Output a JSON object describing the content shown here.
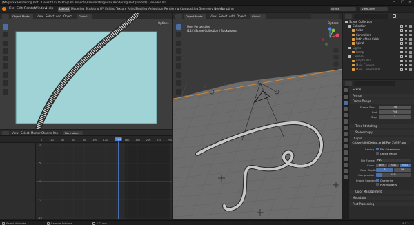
{
  "window": {
    "title": "[Magnifex Rendering Plot] \\Users\\tKri\\Desktop\\3D Projects\\Blender\\Magnifex Rendering Plot [visited] - Blender 4.0"
  },
  "menubar": {
    "items": [
      "File",
      "Edit",
      "Render",
      "Window",
      "Help"
    ],
    "workspaces": [
      "Layout",
      "Modeling",
      "Sculpting",
      "UV Editing",
      "Texture Paint",
      "Shading",
      "Animation",
      "Rendering",
      "Compositing",
      "Geometry Nodes",
      "Scripting"
    ],
    "active_workspace": "Layout",
    "scene_label": "Scene",
    "view_layer_label": "ViewLayer"
  },
  "camera_view": {
    "mode": "Object Mode",
    "menu": [
      "View",
      "Select",
      "Add",
      "Object"
    ],
    "transform": "Global",
    "options_label": "Options"
  },
  "main_viewport": {
    "mode": "Object Mode",
    "menu": [
      "View",
      "Select",
      "Add",
      "Object"
    ],
    "transform": "Global",
    "options_label": "Options",
    "overlay_line1": "User Perspective",
    "overlay_line2": "(144) Scene Collection | Background"
  },
  "graph_editor": {
    "menu": [
      "View",
      "Select",
      "Marker",
      "Channel",
      "Key"
    ],
    "normalize_label": "Normalize",
    "frame_ticks": [
      "0",
      "20",
      "40",
      "60",
      "80",
      "100",
      "120",
      "140",
      "160",
      "180",
      "200",
      "220",
      "240"
    ],
    "current_frame": "144",
    "value_ticks": [
      "10",
      "5",
      "0",
      "-5",
      "-10"
    ]
  },
  "statusbar": {
    "items": [
      "Select Activate",
      "Sample Activate",
      "F-Curve"
    ],
    "version": "4.0.2"
  },
  "outliner": {
    "root_label": "Scene Collection",
    "items": [
      {
        "label": "Collection",
        "depth": 1,
        "color": "#d9d9d9"
      },
      {
        "label": "Cube",
        "depth": 2,
        "color": "#d9d9d9"
      },
      {
        "label": "Controllers",
        "depth": 2,
        "color": "#d9d9d9"
      },
      {
        "label": "Path of the Cable",
        "depth": 2,
        "color": "#d9d9d9"
      },
      {
        "label": "Spiral",
        "depth": 2,
        "color": "#d9d9d9"
      },
      {
        "label": "Lights",
        "depth": 1,
        "color": "#8a8a8a"
      },
      {
        "label": "Lamp",
        "depth": 2,
        "color": "#8a8a8a"
      },
      {
        "label": "Camera",
        "depth": 1,
        "color": "#8a8a8a"
      },
      {
        "label": "Empty.001",
        "depth": 2,
        "color": "#8a8a8a"
      },
      {
        "label": "Main Camera",
        "depth": 2,
        "color": "#8a8a8a"
      },
      {
        "label": "Main Camera.001",
        "depth": 2,
        "color": "#8a8a8a"
      }
    ]
  },
  "properties": {
    "context": "Scene",
    "sections": {
      "format": "Format",
      "frame_range": "Frame Range",
      "time_stretching": "Time Stretching",
      "stereoscopy": "Stereoscopy",
      "output": "Output",
      "metadata": "Metadata",
      "post_processing": "Post Processing",
      "color_management": "Color Management"
    },
    "frame_start_label": "Frame Start",
    "frame_start": "156",
    "end_label": "End",
    "end": "744",
    "step_label": "Step",
    "step": "1",
    "output_path": "C:\\Users\\tKri\\Deskto...e #4\\Part 2\\0597.png",
    "saving_label": "Saving",
    "file_extensions": "File Extensions",
    "cache_result": "Cache Result",
    "file_format_label": "File Format",
    "file_format": "PNG",
    "color_label": "Color",
    "color_options": [
      "BW",
      "RGB",
      "RGBA"
    ],
    "color_depth_label": "Color Depth",
    "color_depth_options": [
      "8",
      "16"
    ],
    "compression_label": "Compression",
    "compression": "15%",
    "image_sequence_label": "Image Sequence",
    "overwrite": "Overwrite",
    "placeholders": "Placeholders"
  }
}
